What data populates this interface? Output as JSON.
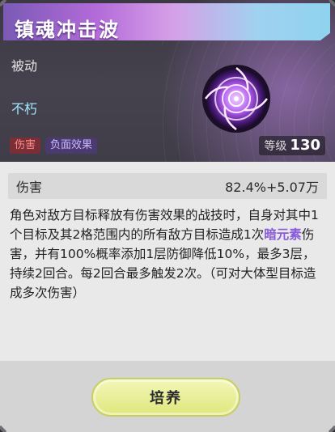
{
  "skill": {
    "name": "镇魂冲击波",
    "type": "被动",
    "element": "不朽",
    "tags": [
      "伤害",
      "负面效果"
    ],
    "level_label": "等级",
    "level_value": "130"
  },
  "stat": {
    "label": "伤害",
    "value": "82.4%+5.07万"
  },
  "description": {
    "part1": "角色对敌方目标释放有伤害效果的战技时，自身对其中1个目标及其2格范围内的所有敌方目标造成1次",
    "highlight": "暗元素",
    "part2": "伤害，并有100%概率添加1层防御降低10%，最多3层，持续2回合。每2回合最多触发2次。（可对大体型目标造成多次伤害）"
  },
  "actions": {
    "upgrade_label": "培养"
  },
  "colors": {
    "highlight": "#8a5bd8",
    "element": "#9fe8ff",
    "button": "#e8ee94"
  },
  "icons": {
    "skill_icon": "dark-vortex-orb-icon"
  }
}
